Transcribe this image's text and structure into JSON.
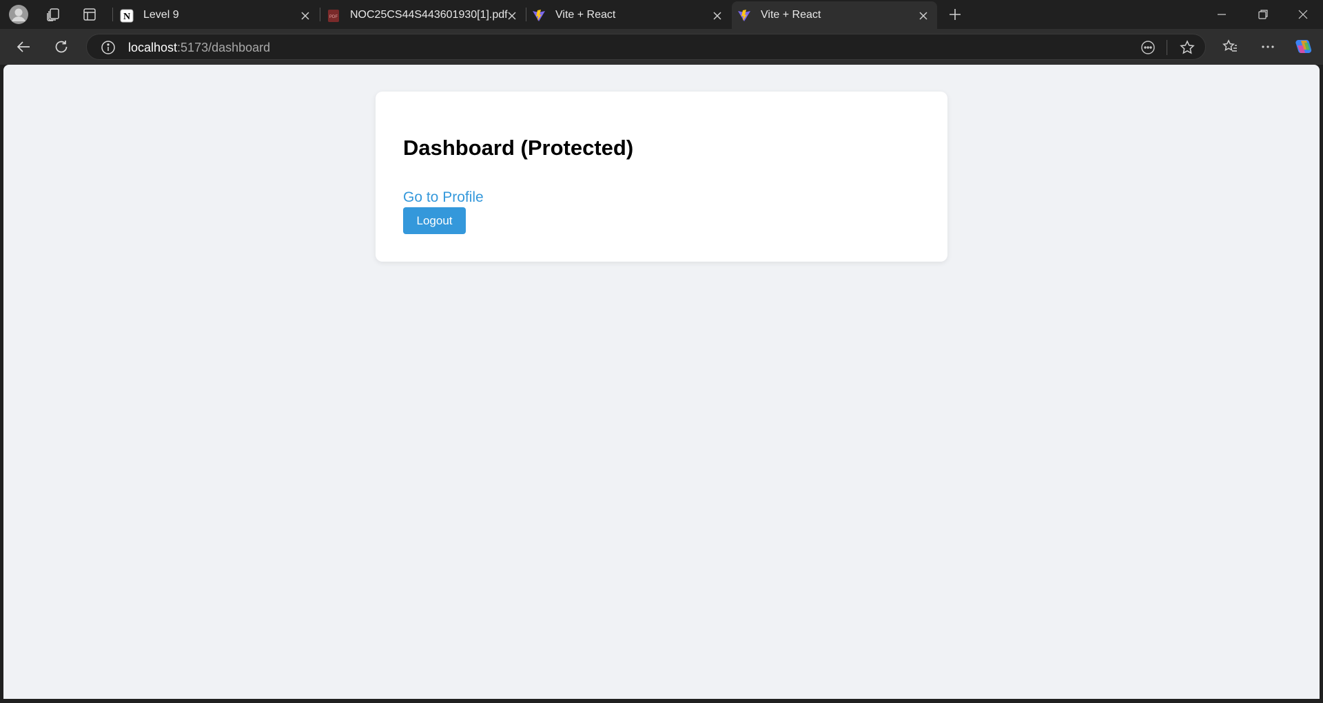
{
  "browser": {
    "tabs": [
      {
        "label": "Level 9",
        "icon": "notion-icon",
        "active": false
      },
      {
        "label": "NOC25CS44S443601930[1].pdf",
        "icon": "pdf-icon",
        "active": false
      },
      {
        "label": "Vite + React",
        "icon": "vite-icon",
        "active": false
      },
      {
        "label": "Vite + React",
        "icon": "vite-icon",
        "active": true
      }
    ],
    "address": {
      "host": "localhost",
      "path": ":5173/dashboard"
    }
  },
  "page": {
    "heading": "Dashboard (Protected)",
    "profile_link": "Go to Profile",
    "logout_label": "Logout"
  },
  "colors": {
    "accent": "#3498db",
    "page_bg": "#f0f2f5",
    "card_bg": "#ffffff",
    "browser_chrome": "#202020"
  }
}
